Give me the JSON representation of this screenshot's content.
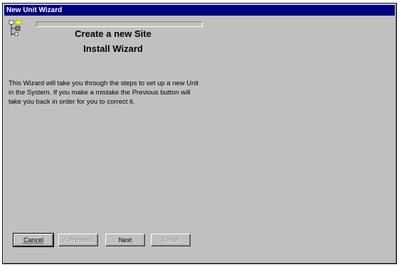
{
  "window": {
    "title": "New Unit Wizard"
  },
  "wizard": {
    "heading_line1": "Create a new Site",
    "heading_line2": "Install  Wizard",
    "description": "This Wizard will take you through the steps to set up a new Unit in the System.  If you make a mistake the Previous button will take you back in order for you to correct it.",
    "progress_fraction": 0
  },
  "buttons": {
    "cancel": "Cancel",
    "previous": "< Previous",
    "next": "Next",
    "finish": "Finish"
  },
  "icons": {
    "tree": "tree-structure-icon"
  },
  "colors": {
    "titlebar": "#000080",
    "face": "#c0c0c0"
  }
}
